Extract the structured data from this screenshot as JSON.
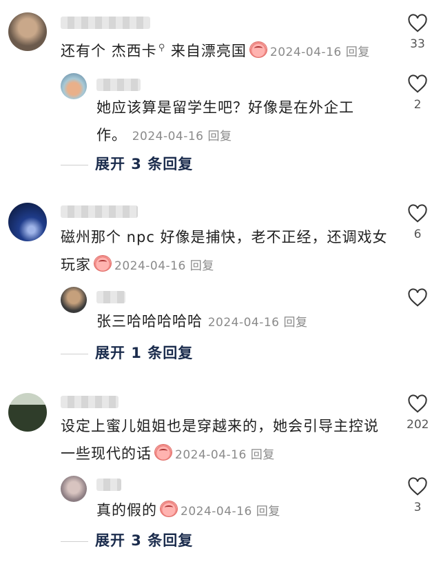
{
  "comments": [
    {
      "text_pre": "还有个 ",
      "highlight": "杰西卡",
      "highlight_icon": "search-icon",
      "text_post": " 来自漂亮国",
      "date": "2024-04-16",
      "reply_label": "回复",
      "likes": "33",
      "avatar_color": "#6b5a4c"
    },
    {
      "text": "她应该算是留学生吧？好像是在外企工作。",
      "date": "2024-04-16",
      "reply_label": "回复",
      "likes": "2",
      "expand_label": "展开 3 条回复",
      "avatar_color": "#7fa3b8"
    },
    {
      "text": "磁州那个 npc 好像是捕快，老不正经，还调戏女玩家",
      "date": "2024-04-16",
      "reply_label": "回复",
      "likes": "6",
      "avatar_color": "#1f3c8a"
    },
    {
      "text": "张三哈哈哈哈哈",
      "date": "2024-04-16",
      "reply_label": "回复",
      "likes": "",
      "expand_label": "展开 1 条回复",
      "avatar_color": "#3a3a3a"
    },
    {
      "text": "设定上蜜儿姐姐也是穿越来的，她会引导主控说一些现代的话",
      "date": "2024-04-16",
      "reply_label": "回复",
      "likes": "202",
      "avatar_color": "#2f3d2a"
    },
    {
      "text": "真的假的",
      "date": "2024-04-16",
      "reply_label": "回复",
      "likes": "3",
      "expand_label": "展开 3 条回复",
      "avatar_color": "#8c7d82"
    }
  ],
  "colors": {
    "accent_text": "#1a2b4c",
    "meta_text": "#8a8a8a"
  }
}
